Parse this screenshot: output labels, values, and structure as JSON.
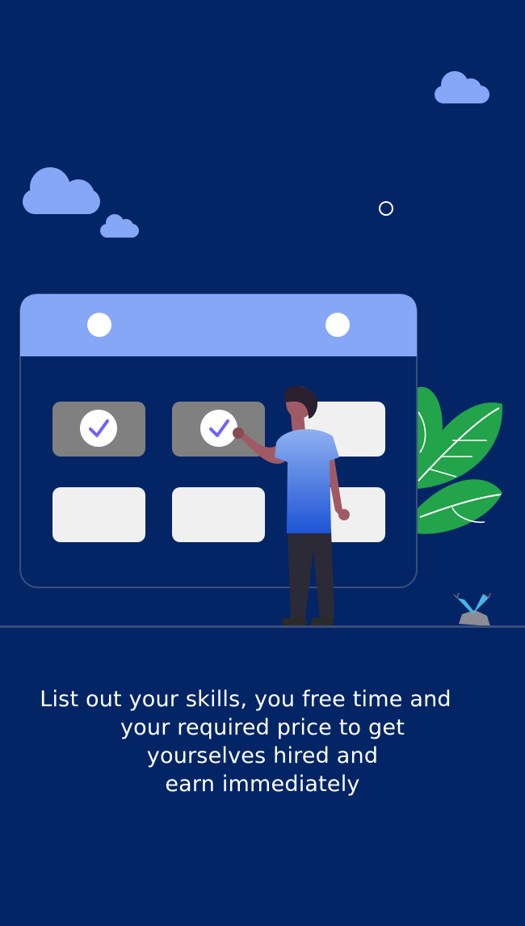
{
  "onboarding": {
    "caption_lines": [
      "List out your skills, you free time and",
      "your required price to get",
      "yourselves hired and",
      "earn immediately"
    ]
  },
  "colors": {
    "background": "#042565",
    "calendar_header": "#86A6F6",
    "cloud": "#86A6F6",
    "selected_slot": "#808080",
    "empty_slot": "#F0F0F0",
    "check": "#6C63FF",
    "leaf": "#23A34A"
  },
  "illustration": {
    "icons": [
      "cloud-icon",
      "calendar-icon",
      "check-icon",
      "person-figure",
      "leaf-plant-icon",
      "rock-sprout-icon"
    ],
    "calendar_slots": {
      "rows": 2,
      "columns": 3,
      "checked_count": 2
    }
  }
}
